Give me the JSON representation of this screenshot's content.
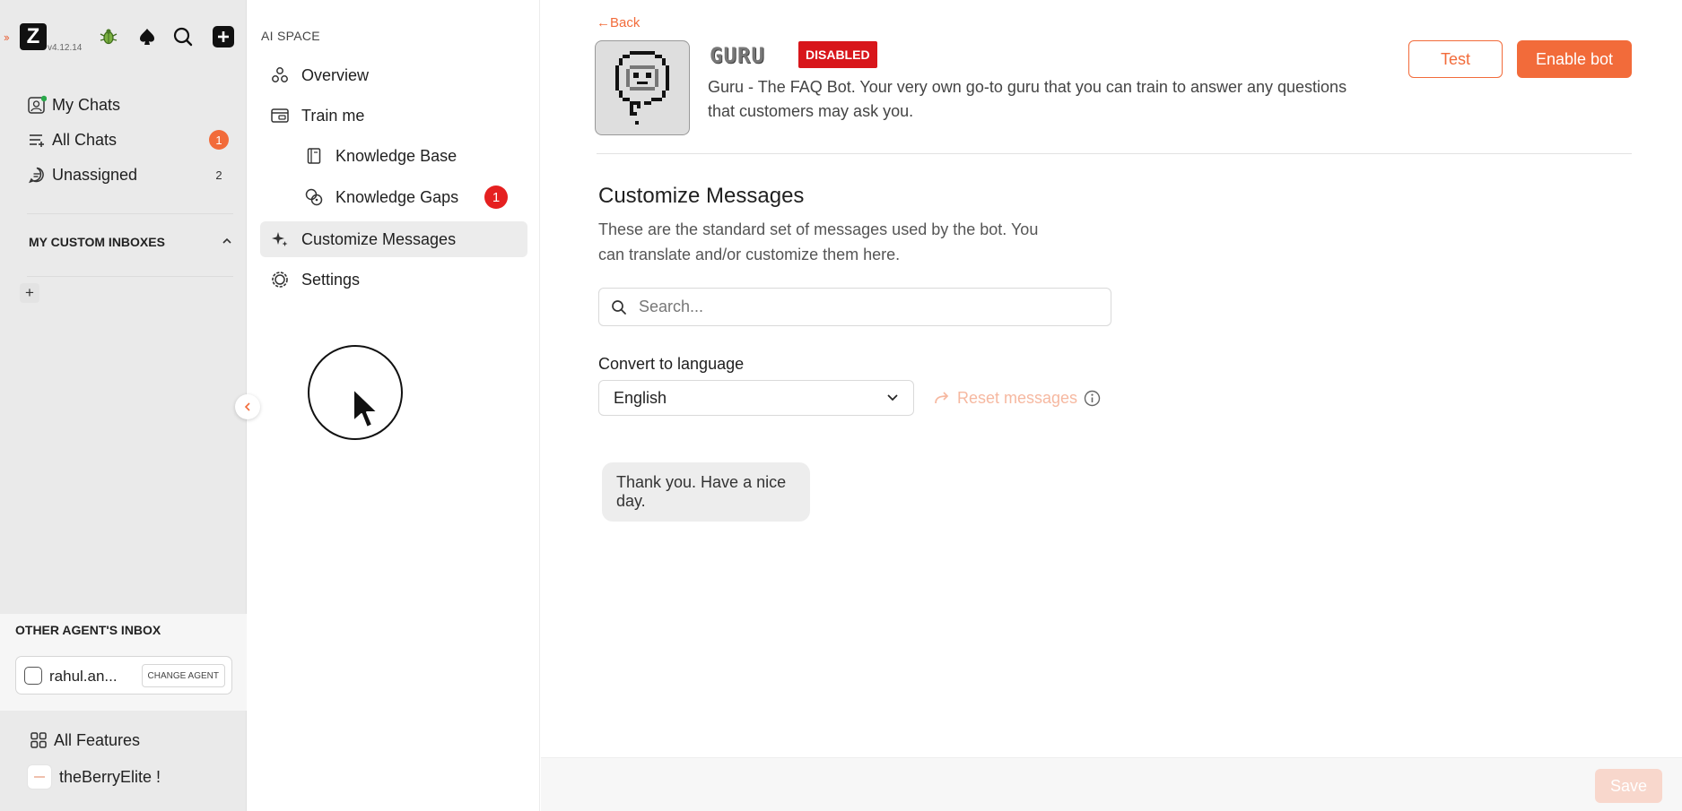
{
  "app": {
    "logo_letter": "Z",
    "version": "v4.12.14"
  },
  "sidebar": {
    "nav": [
      {
        "label": "My Chats",
        "count": ""
      },
      {
        "label": "All Chats",
        "count": "1"
      },
      {
        "label": "Unassigned",
        "count": "2"
      }
    ],
    "custom_inboxes_title": "MY CUSTOM INBOXES",
    "add_label": "+",
    "other_inbox_title": "OTHER AGENT'S INBOX",
    "agent_name": "rahul.an...",
    "change_agent_label": "CHANGE AGENT",
    "all_features_label": "All Features",
    "org_name": "theBerryElite !"
  },
  "ai_nav": {
    "title": "AI SPACE",
    "items": [
      {
        "label": "Overview"
      },
      {
        "label": "Train me"
      },
      {
        "label": "Knowledge Base"
      },
      {
        "label": "Knowledge Gaps",
        "count": "1"
      },
      {
        "label": "Customize Messages"
      },
      {
        "label": "Settings"
      }
    ]
  },
  "bot": {
    "back_label": "←Back",
    "name": "GURU",
    "status": "DISABLED",
    "description": "Guru - The FAQ Bot. Your very own go-to guru that you can train to answer any questions that customers may ask you.",
    "test_label": "Test",
    "enable_label": "Enable bot"
  },
  "customize": {
    "title": "Customize Messages",
    "description": "These are the standard set of messages used by the bot. You can translate and/or customize them here.",
    "search_placeholder": "Search...",
    "language_label": "Convert to language",
    "language_selected": "English",
    "reset_label": "Reset messages",
    "messages": [
      "Thank you. Have a nice day."
    ]
  },
  "footer": {
    "save_label": "Save"
  },
  "colors": {
    "accent": "#f26b3a",
    "badge_red": "#d8161b",
    "count_red": "#e52020"
  }
}
